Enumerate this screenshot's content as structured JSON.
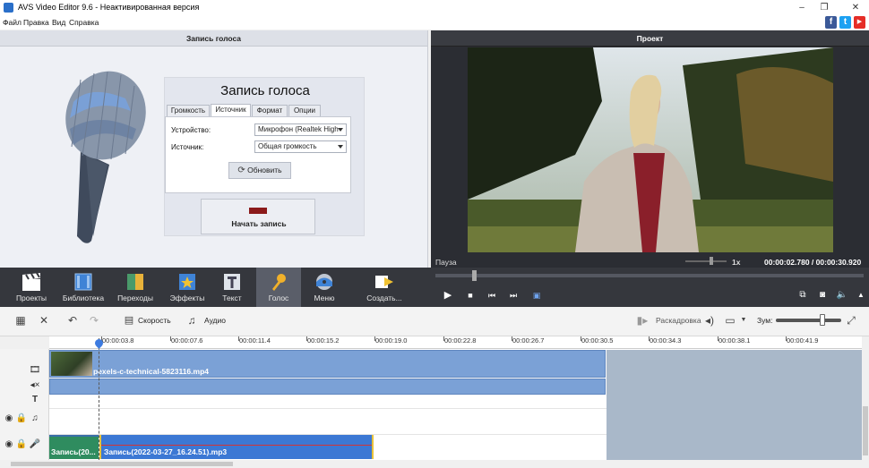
{
  "window": {
    "title": "AVS Video Editor 9.6 - Неактивированная версия",
    "controls": [
      "–",
      "❐",
      "✕"
    ]
  },
  "menu": [
    "Файл",
    "Правка",
    "Вид",
    "Справка"
  ],
  "social": {
    "facebook": "f",
    "twitter": "t",
    "youtube": "▶"
  },
  "voice_panel": {
    "header": "Запись голоса",
    "title": "Запись голоса",
    "tabs": [
      "Громкость",
      "Источник",
      "Формат",
      "Опции"
    ],
    "active_tab": "Источник",
    "device_label": "Устройство:",
    "device_value": "Микрофон (Realtek High",
    "source_label": "Источник:",
    "source_value": "Общая громкость",
    "refresh_label": "Обновить",
    "record_label": "Начать запись"
  },
  "project_panel": {
    "header": "Проект",
    "status": "Пауза",
    "speed": "1x",
    "time": "00:00:02.780 / 00:00:30.920"
  },
  "toolbar": {
    "tools": [
      {
        "label": "Проекты",
        "icon": "clapper-icon"
      },
      {
        "label": "Библиотека",
        "icon": "film-library-icon"
      },
      {
        "label": "Переходы",
        "icon": "transitions-icon"
      },
      {
        "label": "Эффекты",
        "icon": "effects-star-icon"
      },
      {
        "label": "Текст",
        "icon": "text-t-icon"
      },
      {
        "label": "Голос",
        "icon": "microphone-icon"
      },
      {
        "label": "Меню",
        "icon": "disc-menu-icon"
      },
      {
        "label": "Создать...",
        "icon": "create-arrow-icon"
      }
    ],
    "active": "Голос"
  },
  "timeline_toolbar": {
    "speed_label": "Скорость",
    "audio_label": "Аудио",
    "storyboard_label": "Раскадровка",
    "zoom_label": "Зум:",
    "zoom_level": 0.67
  },
  "ruler": {
    "ticks": [
      "00:00:03.8",
      "00:00:07.6",
      "00:00:11.4",
      "00:00:15.2",
      "00:00:19.0",
      "00:00:22.8",
      "00:00:26.7",
      "00:00:30.5",
      "00:00:34.3",
      "00:00:38.1",
      "00:00:41.9"
    ]
  },
  "tracks": {
    "video_clip": "pexels-c-technical-5823116.mp4",
    "audio_green": "Запись(20...",
    "audio_clip": "Запись(2022-03-27_16.24.51).mp3"
  },
  "colors": {
    "accent_blue": "#3c78d4",
    "clip_blue": "#7ba1d6",
    "dark_toolbar": "#35373d",
    "record_red": "#8b1a1a"
  }
}
